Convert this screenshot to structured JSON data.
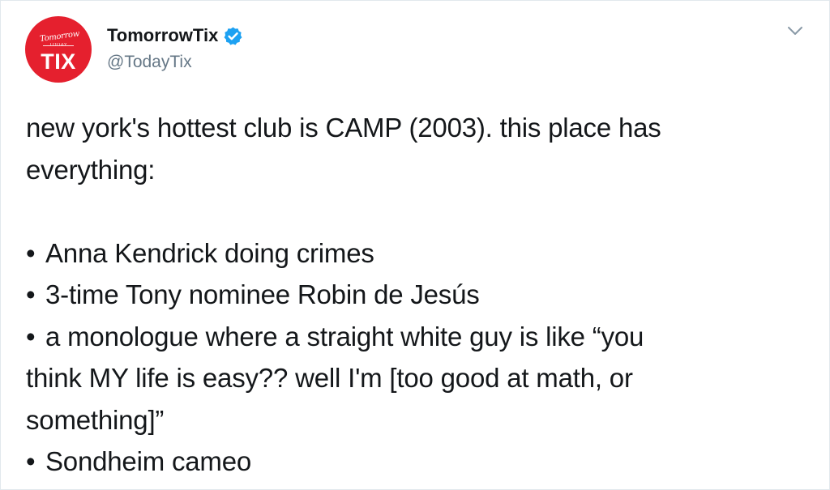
{
  "account": {
    "avatar_script_text": "Tomorrow",
    "avatar_strike_text": "TODAY",
    "avatar_text": "TIX",
    "display_name": "TomorrowTix",
    "handle": "@TodayTix",
    "verified_icon": "verified-badge-icon",
    "brand_color": "#e5202e",
    "verified_color": "#1da1f2"
  },
  "menu": {
    "icon": "chevron-down-icon"
  },
  "tweet": {
    "intro_lines": [
      "new york's hottest club is CAMP (2003). this place has",
      "everything:"
    ],
    "bullet_symbol": "•",
    "bullets": [
      [
        "Anna Kendrick doing crimes"
      ],
      [
        "3-time Tony nominee Robin de Jesús"
      ],
      [
        "a monologue where a straight white guy is like “you",
        "think MY life is easy?? well I'm [too good at math, or",
        "something]”"
      ],
      [
        "Sondheim cameo"
      ]
    ]
  }
}
